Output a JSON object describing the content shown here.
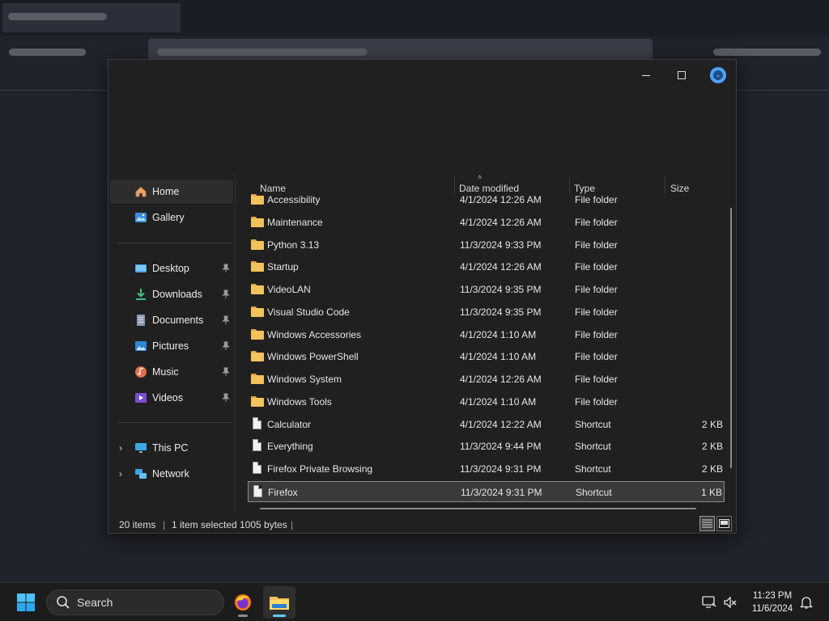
{
  "window": {
    "minimize_label": "Minimize",
    "maximize_label": "Maximize"
  },
  "sidebar": {
    "quick": [
      {
        "label": "Home",
        "icon": "home-icon"
      },
      {
        "label": "Gallery",
        "icon": "gallery-icon"
      }
    ],
    "pinned": [
      {
        "label": "Desktop",
        "icon": "desktop-icon"
      },
      {
        "label": "Downloads",
        "icon": "downloads-icon"
      },
      {
        "label": "Documents",
        "icon": "documents-icon"
      },
      {
        "label": "Pictures",
        "icon": "pictures-icon"
      },
      {
        "label": "Music",
        "icon": "music-icon"
      },
      {
        "label": "Videos",
        "icon": "videos-icon"
      }
    ],
    "devices": [
      {
        "label": "This PC",
        "icon": "pc-icon"
      },
      {
        "label": "Network",
        "icon": "network-icon"
      }
    ]
  },
  "columns": {
    "name": "Name",
    "date": "Date modified",
    "type": "Type",
    "size": "Size"
  },
  "files": [
    {
      "name": "Accessibility",
      "date": "4/1/2024 12:26 AM",
      "type": "File folder",
      "size": "",
      "kind": "folder"
    },
    {
      "name": "Maintenance",
      "date": "4/1/2024 12:26 AM",
      "type": "File folder",
      "size": "",
      "kind": "folder"
    },
    {
      "name": "Python 3.13",
      "date": "11/3/2024 9:33 PM",
      "type": "File folder",
      "size": "",
      "kind": "folder"
    },
    {
      "name": "Startup",
      "date": "4/1/2024 12:26 AM",
      "type": "File folder",
      "size": "",
      "kind": "folder"
    },
    {
      "name": "VideoLAN",
      "date": "11/3/2024 9:35 PM",
      "type": "File folder",
      "size": "",
      "kind": "folder"
    },
    {
      "name": "Visual Studio Code",
      "date": "11/3/2024 9:35 PM",
      "type": "File folder",
      "size": "",
      "kind": "folder"
    },
    {
      "name": "Windows Accessories",
      "date": "4/1/2024 1:10 AM",
      "type": "File folder",
      "size": "",
      "kind": "folder"
    },
    {
      "name": "Windows PowerShell",
      "date": "4/1/2024 1:10 AM",
      "type": "File folder",
      "size": "",
      "kind": "folder"
    },
    {
      "name": "Windows System",
      "date": "4/1/2024 12:26 AM",
      "type": "File folder",
      "size": "",
      "kind": "folder"
    },
    {
      "name": "Windows Tools",
      "date": "4/1/2024 1:10 AM",
      "type": "File folder",
      "size": "",
      "kind": "folder"
    },
    {
      "name": "Calculator",
      "date": "4/1/2024 12:22 AM",
      "type": "Shortcut",
      "size": "2 KB",
      "kind": "shortcut"
    },
    {
      "name": "Everything",
      "date": "11/3/2024 9:44 PM",
      "type": "Shortcut",
      "size": "2 KB",
      "kind": "shortcut"
    },
    {
      "name": "Firefox Private Browsing",
      "date": "11/3/2024 9:31 PM",
      "type": "Shortcut",
      "size": "2 KB",
      "kind": "shortcut"
    },
    {
      "name": "Firefox",
      "date": "11/3/2024 9:31 PM",
      "type": "Shortcut",
      "size": "1 KB",
      "kind": "shortcut",
      "selected": true
    }
  ],
  "status": {
    "items": "20 items",
    "selection": "1 item selected",
    "bytes": "1005 bytes"
  },
  "taskbar": {
    "search_label": "Search",
    "time": "11:23 PM",
    "date": "11/6/2024"
  },
  "colors": {
    "accent": "#60cdff",
    "folder": "#f2c25c",
    "window_bg": "#202020"
  }
}
